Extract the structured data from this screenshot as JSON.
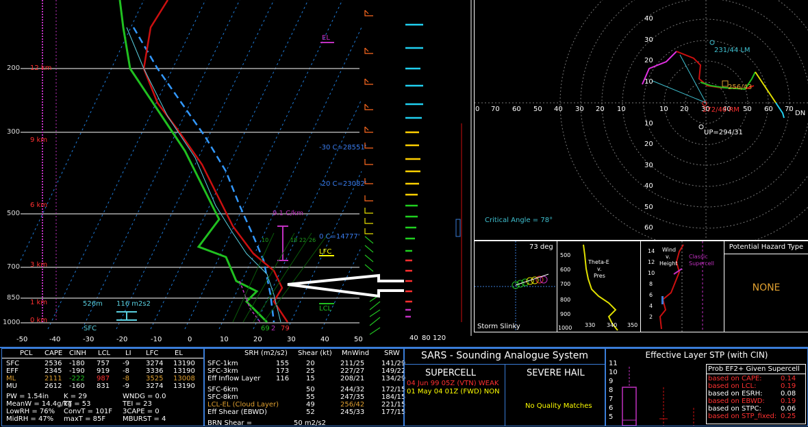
{
  "skewt": {
    "pressure_ticks": [
      "200",
      "300",
      "500",
      "700",
      "850",
      "1000"
    ],
    "temp_ticks": [
      "-50",
      "-40",
      "-30",
      "-20",
      "-10",
      "0",
      "10",
      "20",
      "30",
      "40",
      "50"
    ],
    "height_labels": [
      "12 km",
      "9 km",
      "6 km",
      "3 km",
      "1 km",
      "0 km"
    ],
    "annotations": {
      "el": "EL",
      "lfc": "LFC",
      "lcl": "LCL",
      "lapse": "9.1 C/km",
      "m30": "-30 C=28551'",
      "m20": "-20 C=23082'",
      "zero": "0 C=14777'",
      "eff_depth": "526m",
      "eff_srh": "116 m2s2",
      "sfc": "SFC",
      "dew_sfc": "69",
      "wb_sfc": "2",
      "t_sfc": "79",
      "wbz_nums": [
        "10",
        "18",
        "22",
        "26"
      ]
    },
    "wind_axis": [
      "40",
      "80",
      "120"
    ]
  },
  "hodograph": {
    "rings_left": [
      "70",
      "60",
      "50",
      "40",
      "30",
      "20",
      "10",
      "0"
    ],
    "rings_right": [
      "10",
      "20",
      "30",
      "40",
      "50",
      "60",
      "70"
    ],
    "rings_up": [
      "40",
      "30",
      "20",
      "10"
    ],
    "rings_down": [
      "10",
      "20",
      "30",
      "40",
      "50",
      "60"
    ],
    "lm": "231/44 LM",
    "rm": "272/40 RM",
    "mean": "256/43",
    "up": "UP=294/31",
    "dn": "DN",
    "critical_angle": "Critical Angle = 78°"
  },
  "slinky": {
    "deg": "73 deg",
    "title": "Storm Slinky"
  },
  "thetae": {
    "title_lines": [
      "Theta-E",
      "v.",
      "Pres"
    ],
    "p_ticks": [
      "500",
      "600",
      "700",
      "800",
      "900",
      "1000"
    ],
    "x_ticks": [
      "330",
      "340",
      "350"
    ]
  },
  "wind_height": {
    "title_lines": [
      "Wind",
      "v.",
      "Height"
    ],
    "classic": [
      "Classic",
      "Supercell"
    ],
    "h_ticks": [
      "14",
      "12",
      "10",
      "8",
      "6",
      "4",
      "2"
    ]
  },
  "hazard": {
    "title": "Potential Hazard Type",
    "value": "NONE"
  },
  "thermo_table": {
    "headers": [
      "PCL",
      "CAPE",
      "CINH",
      "LCL",
      "LI",
      "LFC",
      "EL"
    ],
    "rows": [
      [
        "SFC",
        "2536",
        "-180",
        "757",
        "-9",
        "3274",
        "13190"
      ],
      [
        "EFF",
        "2345",
        "-190",
        "919",
        "-8",
        "3336",
        "13190"
      ],
      [
        "ML",
        "2111",
        "-222",
        "987",
        "-8",
        "3525",
        "13008"
      ],
      [
        "MU",
        "2612",
        "-160",
        "831",
        "-9",
        "3274",
        "13190"
      ]
    ],
    "misc": [
      [
        "PW = 1.54in",
        "K = 29",
        "WNDG = 0.0"
      ],
      [
        "MeanW = 14.4g/kg",
        "TT = 53",
        "TEI = 23"
      ],
      [
        "LowRH = 76%",
        "ConvT = 101F",
        "3CAPE = 0"
      ],
      [
        "MidRH = 47%",
        "maxT = 85F",
        "MBURST = 4"
      ]
    ]
  },
  "kin_table": {
    "headers": [
      "SRH (m2/s2)",
      "Shear (kt)",
      "MnWind",
      "SRW"
    ],
    "rows": [
      [
        "SFC-1km",
        "155",
        "20",
        "211/25",
        "141/29"
      ],
      [
        "SFC-3km",
        "173",
        "25",
        "227/27",
        "149/22"
      ],
      [
        "Eff Inflow Layer",
        "116",
        "15",
        "208/21",
        "134/29"
      ],
      [
        "SFC-6km",
        "",
        "50",
        "244/32",
        "172/15"
      ],
      [
        "SFC-8km",
        "",
        "55",
        "247/35",
        "184/15"
      ],
      [
        "LCL-EL (Cloud Layer)",
        "",
        "49",
        "256/42",
        "221/15"
      ],
      [
        "Eff Shear (EBWD)",
        "",
        "52",
        "245/33",
        "177/15"
      ]
    ],
    "brn": "BRN Shear =",
    "brn_val": "50 m2/s2"
  },
  "sars": {
    "title": "SARS - Sounding Analogue System",
    "supercell": "SUPERCELL",
    "hail": "SEVERE HAIL",
    "match1": "04 Jun 99 05Z (VTN)  WEAK",
    "match2": "01 May 04 01Z (FWD) NON",
    "no_match": "No Quality Matches"
  },
  "stp": {
    "title": "Effective Layer STP (with CIN)",
    "y_ticks": [
      "11",
      "10",
      "9",
      "8",
      "7",
      "6",
      "5"
    ],
    "prob_title": "Prob EF2+ Given Supercell",
    "probs": [
      [
        "based on CAPE:",
        "0.14",
        "#ff3030"
      ],
      [
        "based on LCL:",
        "0.19",
        "#ff3030"
      ],
      [
        "based on ESRH:",
        "0.08",
        "#ffffff"
      ],
      [
        "based on EBWD:",
        "0.19",
        "#ff3030"
      ],
      [
        "based on STPC:",
        "0.06",
        "#ffffff"
      ],
      [
        "based on STP_fixed:",
        "0.25",
        "#ff3030"
      ]
    ]
  }
}
